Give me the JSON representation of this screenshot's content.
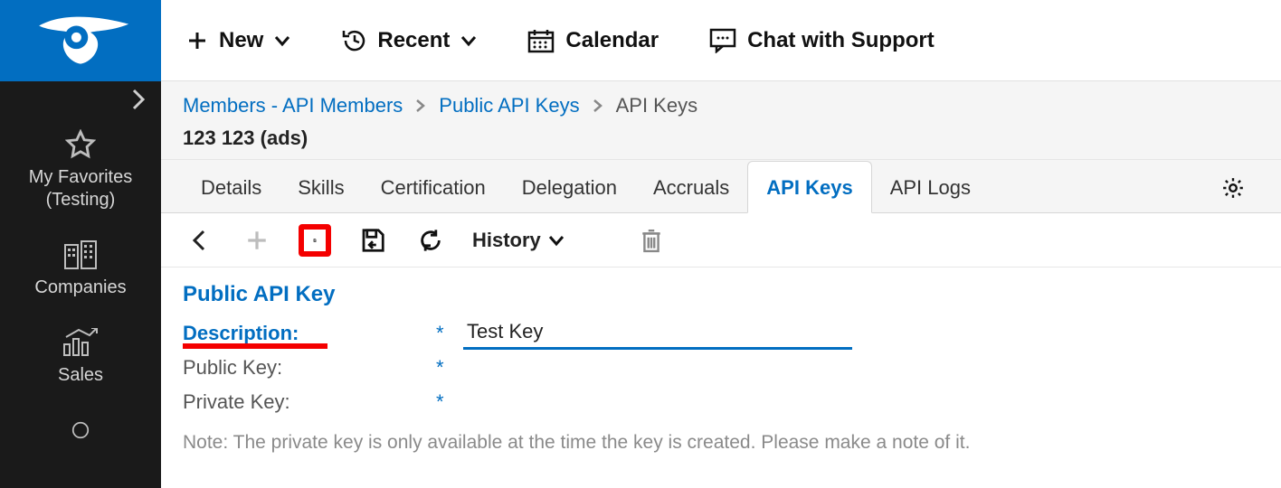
{
  "topbar": {
    "new_label": "New",
    "recent_label": "Recent",
    "calendar_label": "Calendar",
    "chat_label": "Chat with Support"
  },
  "breadcrumb": {
    "level1": "Members - API Members",
    "level2": "Public API Keys",
    "level3": "API Keys",
    "subline": "123 123 (ads)"
  },
  "tabs": {
    "details": "Details",
    "skills": "Skills",
    "certification": "Certification",
    "delegation": "Delegation",
    "accruals": "Accruals",
    "api_keys": "API Keys",
    "api_logs": "API Logs"
  },
  "actionbar": {
    "history_label": "History"
  },
  "sidebar": {
    "favorites_label": "My Favorites (Testing)",
    "companies_label": "Companies",
    "sales_label": "Sales"
  },
  "form": {
    "section_title": "Public API Key",
    "description_label": "Description:",
    "description_value": "Test Key",
    "public_key_label": "Public Key:",
    "private_key_label": "Private Key:",
    "required_mark": "*",
    "note": "Note: The private key is only available at the time the key is created. Please make a note of it."
  }
}
